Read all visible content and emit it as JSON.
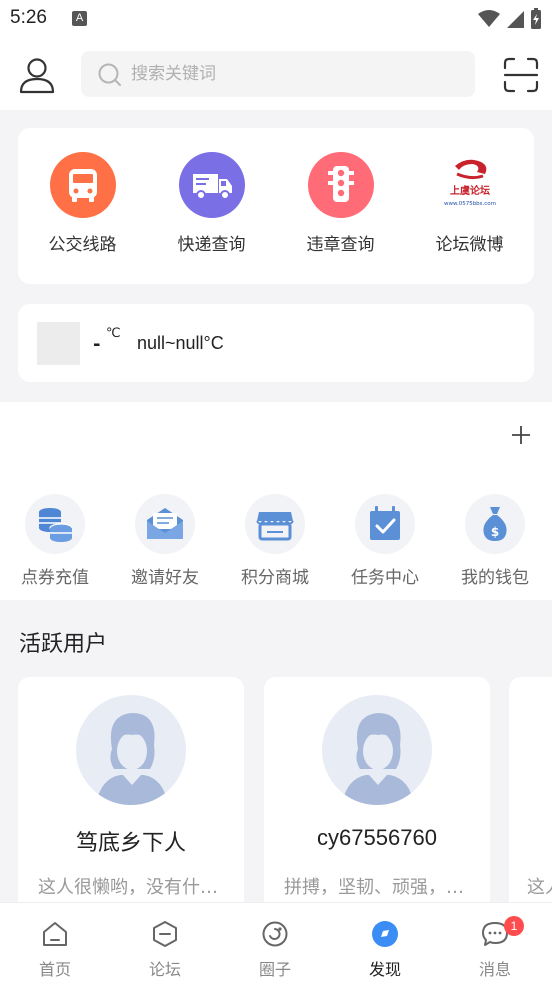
{
  "status_bar": {
    "time": "5:26",
    "notification_letter": "A"
  },
  "header": {
    "search_placeholder": "搜索关键词"
  },
  "services": [
    {
      "label": "公交线路",
      "icon": "bus-icon",
      "color": "#ff7046"
    },
    {
      "label": "快递查询",
      "icon": "truck-icon",
      "color": "#7b6fe6"
    },
    {
      "label": "违章查询",
      "icon": "traffic-light-icon",
      "color": "#ff6b76"
    },
    {
      "label": "论坛微博",
      "icon": "forum-logo",
      "logo_text": "上虞论坛",
      "logo_url": "www.0575bbs.com"
    }
  ],
  "weather": {
    "temp": "-",
    "unit": "℃",
    "range": "null~null°C"
  },
  "tools": [
    {
      "label": "点券充值",
      "icon": "coins-icon"
    },
    {
      "label": "邀请好友",
      "icon": "envelope-icon"
    },
    {
      "label": "积分商城",
      "icon": "shop-icon"
    },
    {
      "label": "任务中心",
      "icon": "calendar-check-icon"
    },
    {
      "label": "我的钱包",
      "icon": "money-bag-icon"
    }
  ],
  "active_users": {
    "title": "活跃用户",
    "users": [
      {
        "name": "笃底乡下人",
        "bio": "这人很懒哟，没有什么介绍"
      },
      {
        "name": "cy67556760",
        "bio": "拼搏，坚韧、顽强，进取"
      },
      {
        "name": "",
        "bio": "这人"
      }
    ]
  },
  "tabs": [
    {
      "label": "首页",
      "icon": "home-icon"
    },
    {
      "label": "论坛",
      "icon": "forum-icon"
    },
    {
      "label": "圈子",
      "icon": "circle-icon"
    },
    {
      "label": "发现",
      "icon": "discover-icon",
      "active": true
    },
    {
      "label": "消息",
      "icon": "message-icon",
      "badge": "1"
    }
  ],
  "colors": {
    "accent": "#3b8cf5",
    "badge": "#ff4d4f",
    "tool_icon": "#5b8fd6"
  }
}
